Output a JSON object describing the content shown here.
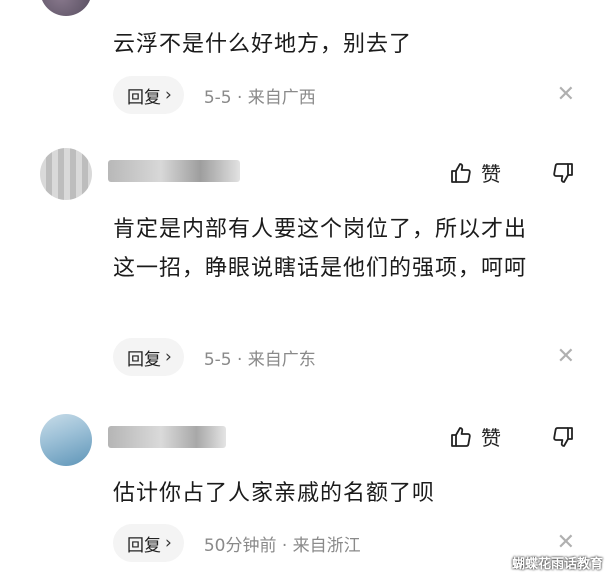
{
  "comments": [
    {
      "text": "云浮不是什么好地方，别去了",
      "reply_label": "回复",
      "meta": "5-5 · 来自广西",
      "close": "✕"
    },
    {
      "text": "肯定是内部有人要这个岗位了，所以才出这一招，睁眼说瞎话是他们的强项，呵呵",
      "like_label": "赞",
      "reply_label": "回复",
      "meta": "5-5 · 来自广东",
      "close": "✕"
    },
    {
      "text": "估计你占了人家亲戚的名额了呗",
      "like_label": "赞",
      "reply_label": "回复",
      "meta": "50分钟前 · 来自浙江",
      "close": "✕"
    }
  ],
  "icons": {
    "like": "thumbs-up-icon",
    "dislike": "thumbs-down-icon",
    "reply_chevron": "chevron-right-icon",
    "close": "close-icon"
  },
  "watermark": "蝴蝶花雨话教育",
  "colors": {
    "reply_bg": "#f4f4f4",
    "meta_text": "#8a8a8a",
    "close_icon": "#b0b0b0"
  }
}
